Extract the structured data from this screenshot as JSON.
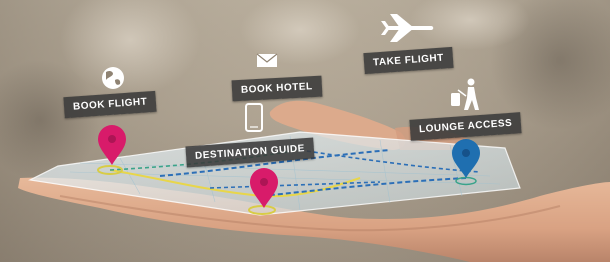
{
  "labels": {
    "book_flight": "BOOK FLIGHT",
    "book_hotel": "BOOK HOTEL",
    "take_flight": "TAKE FLIGHT",
    "destination_guide": "DESTINATION GUIDE",
    "lounge_access": "LOUNGE ACCESS"
  },
  "icons": {
    "globe": "globe-icon",
    "envelope": "envelope-icon",
    "phone": "phone-icon",
    "airplane": "airplane-icon",
    "traveler": "traveler-with-luggage-icon",
    "pin_pink": "map-pin-icon",
    "pin_blue": "map-pin-icon"
  },
  "colors": {
    "label_bg": "#3a3a3a",
    "pin_pink": "#d81b6a",
    "pin_blue": "#1f6fb0",
    "route_blue": "#2c6fb7",
    "route_yellow": "#e8d64a",
    "route_green": "#3aa38a"
  }
}
